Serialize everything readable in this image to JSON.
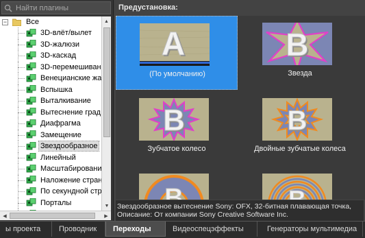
{
  "search": {
    "placeholder": "Найти плагины"
  },
  "tree": {
    "root_label": "Все",
    "items": [
      "3D-влёт/вылет",
      "3D-жалюзи",
      "3D-каскад",
      "3D-перемешиван",
      "Венецианские жа",
      "Вспышка",
      "Выталкивание",
      "Вытеснение град",
      "Диафрагма",
      "Замещение",
      "Звездообразное",
      "Линейный",
      "Масштабировани",
      "Наложение стран",
      "По секундной стр",
      "Порталы",
      "Р"
    ],
    "selected_index": 10
  },
  "presets": {
    "title": "Предустановка:",
    "items": [
      {
        "label": "(По умолчанию)",
        "letter": "A"
      },
      {
        "label": "Звезда",
        "letter": "B"
      },
      {
        "label": "Зубчатое колесо",
        "letter": "B"
      },
      {
        "label": "Двойные зубчатые колеса",
        "letter": "B"
      },
      {
        "label": "",
        "letter": "B"
      },
      {
        "label": "",
        "letter": "B"
      }
    ]
  },
  "description": {
    "line1": "Звездообразное вытеснение Sony: OFX, 32-битная плавающая точка,",
    "line2": "Описание: От компании Sony Creative Software Inc."
  },
  "tabs": [
    "ы проекта",
    "Проводник",
    "Переходы",
    "Видеоспецэффекты",
    "Генераторы мультимедиа"
  ],
  "active_tab": "Переходы",
  "colors": {
    "selection": "#2f8ee8",
    "star_pink": "#e040c8",
    "star_orange": "#f08a20",
    "thumbnail_bg": "#b8b08c",
    "thumbnail_blue": "#7a8ab8"
  }
}
